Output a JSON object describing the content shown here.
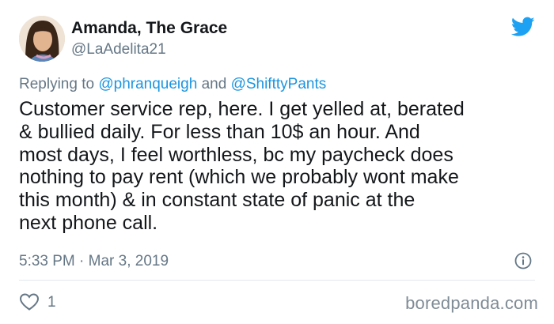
{
  "author": {
    "name": "Amanda, The Grace",
    "handle": "@LaAdelita21"
  },
  "reply": {
    "prefix": "Replying to ",
    "mention_1": "@phranqueigh",
    "connector": " and ",
    "mention_2": "@ShifttyPants"
  },
  "tweet": {
    "text": "Customer service rep, here. I get yelled at, berated\n& bullied daily. For less than 10$ an hour. And\nmost days, I feel worthless, bc my paycheck does\nnothing to pay rent (which we probably wont make\nthis month) & in constant state of panic at the\nnext phone call.",
    "timestamp": "5:33 PM · Mar 3, 2019"
  },
  "actions": {
    "like_count": "1"
  },
  "watermark": "boredpanda.com",
  "icons": {
    "brand": "twitter-bird-icon",
    "info": "info-icon",
    "like": "heart-icon"
  },
  "colors": {
    "twitter_blue": "#1da1f2",
    "mention_blue": "#1b95e0",
    "secondary_text": "#657786",
    "primary_text": "#14171a"
  }
}
